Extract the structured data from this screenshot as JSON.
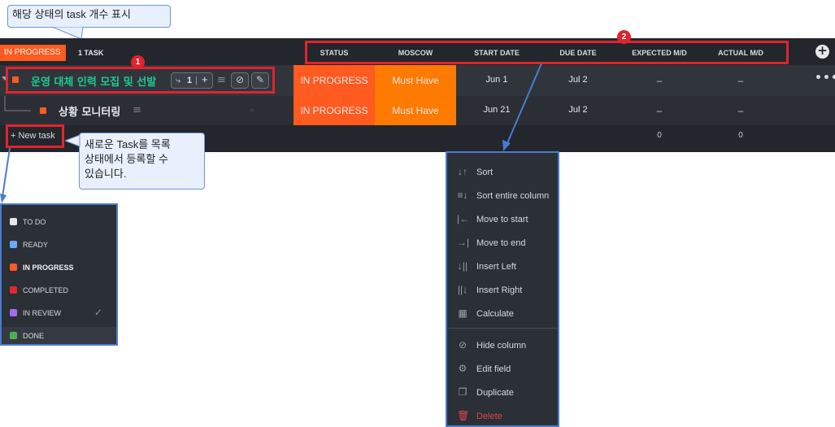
{
  "callouts": {
    "task_count": "해당 상태의 task 개수 표시",
    "new_task_line1": "새로운 Task를 목록",
    "new_task_line2": "상태에서 등록할 수",
    "new_task_line3": "있습니다."
  },
  "badges": {
    "one": "1",
    "two": "2"
  },
  "group": {
    "status_label": "IN PROGRESS",
    "task_count": "1 TASK",
    "accent": "#ff5a1f"
  },
  "columns": [
    "STATUS",
    "MOSCOW",
    "START DATE",
    "DUE DATE",
    "EXPECTED M/D",
    "ACTUAL M/D"
  ],
  "tasks": [
    {
      "name": "운영 대체 인력 모집 및 선발",
      "subtask_count": "1",
      "plus": "+",
      "status": "IN PROGRESS",
      "moscow": "Must Have",
      "start": "Jun 1",
      "due": "Jul 2",
      "expected": "–",
      "actual": "–"
    },
    {
      "name": "상황 모니터링",
      "status": "IN PROGRESS",
      "moscow": "Must Have",
      "start": "Jun 21",
      "due": "Jul 2",
      "expected": "–",
      "actual": "–"
    }
  ],
  "footer": {
    "new_task": "+ New task",
    "expected_total": "0",
    "actual_total": "0"
  },
  "status_menu": [
    {
      "label": "TO DO",
      "color": "#e6e6e6"
    },
    {
      "label": "READY",
      "color": "#6fa8ff"
    },
    {
      "label": "IN PROGRESS",
      "color": "#ff5a1f"
    },
    {
      "label": "COMPLETED",
      "color": "#e5262c"
    },
    {
      "label": "IN REVIEW",
      "color": "#a26cf0"
    },
    {
      "label": "DONE",
      "color": "#4caf50"
    }
  ],
  "column_menu": [
    {
      "label": "Sort",
      "icon": "sort-icon"
    },
    {
      "label": "Sort entire column",
      "icon": "sort-column-icon"
    },
    {
      "label": "Move to start",
      "icon": "move-start-icon"
    },
    {
      "label": "Move to end",
      "icon": "move-end-icon"
    },
    {
      "label": "Insert Left",
      "icon": "insert-left-icon"
    },
    {
      "label": "Insert Right",
      "icon": "insert-right-icon"
    },
    {
      "label": "Calculate",
      "icon": "calculator-icon"
    },
    {
      "label": "Hide column",
      "icon": "eye-off-icon"
    },
    {
      "label": "Edit field",
      "icon": "gear-icon"
    },
    {
      "label": "Duplicate",
      "icon": "copy-icon"
    },
    {
      "label": "Delete",
      "icon": "trash-icon"
    }
  ]
}
